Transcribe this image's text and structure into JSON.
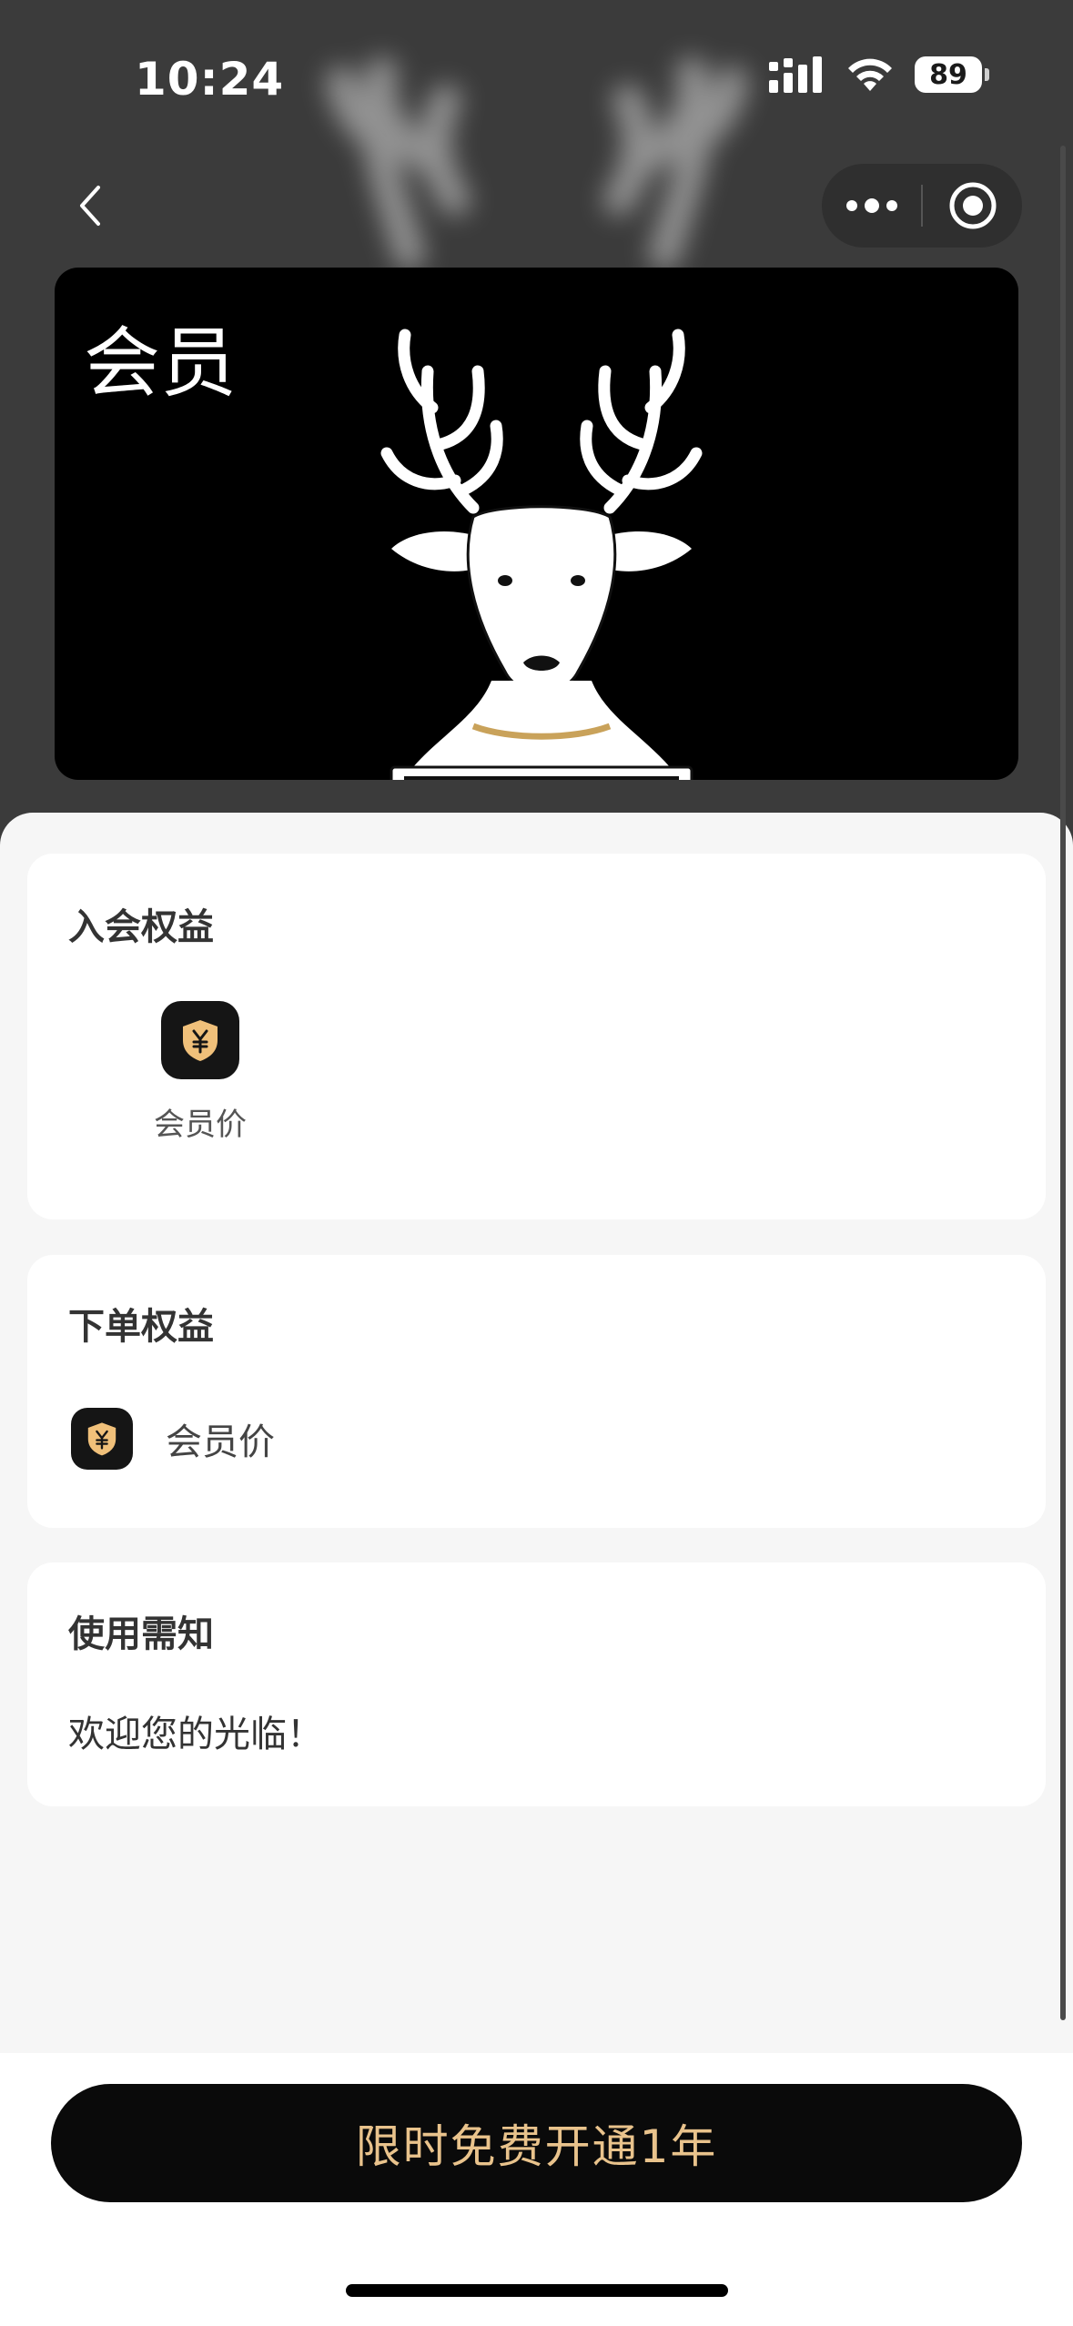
{
  "status_bar": {
    "time": "10:24",
    "battery_level": "89",
    "signal_icon": "cellular-signal-icon",
    "wifi_icon": "wifi-icon"
  },
  "nav": {
    "back_icon": "chevron-left-icon",
    "more_icon": "more-dots-icon",
    "close_icon": "target-circle-icon"
  },
  "member_card": {
    "title": "会员",
    "logo_icon": "deer-logo-icon"
  },
  "sections": {
    "join_benefits": {
      "title": "入会权益",
      "items": [
        {
          "label": "会员价",
          "icon": "yen-shield-icon"
        }
      ]
    },
    "order_benefits": {
      "title": "下单权益",
      "items": [
        {
          "label": "会员价",
          "icon": "yen-shield-icon"
        }
      ]
    },
    "usage_notice": {
      "title": "使用需知",
      "text": "欢迎您的光临！"
    }
  },
  "cta": {
    "label": "限时免费开通1年"
  },
  "colors": {
    "accent_gold": "#e9c38c",
    "button_dark": "#0a0a0a",
    "sheet_bg": "#f6f6f6"
  }
}
